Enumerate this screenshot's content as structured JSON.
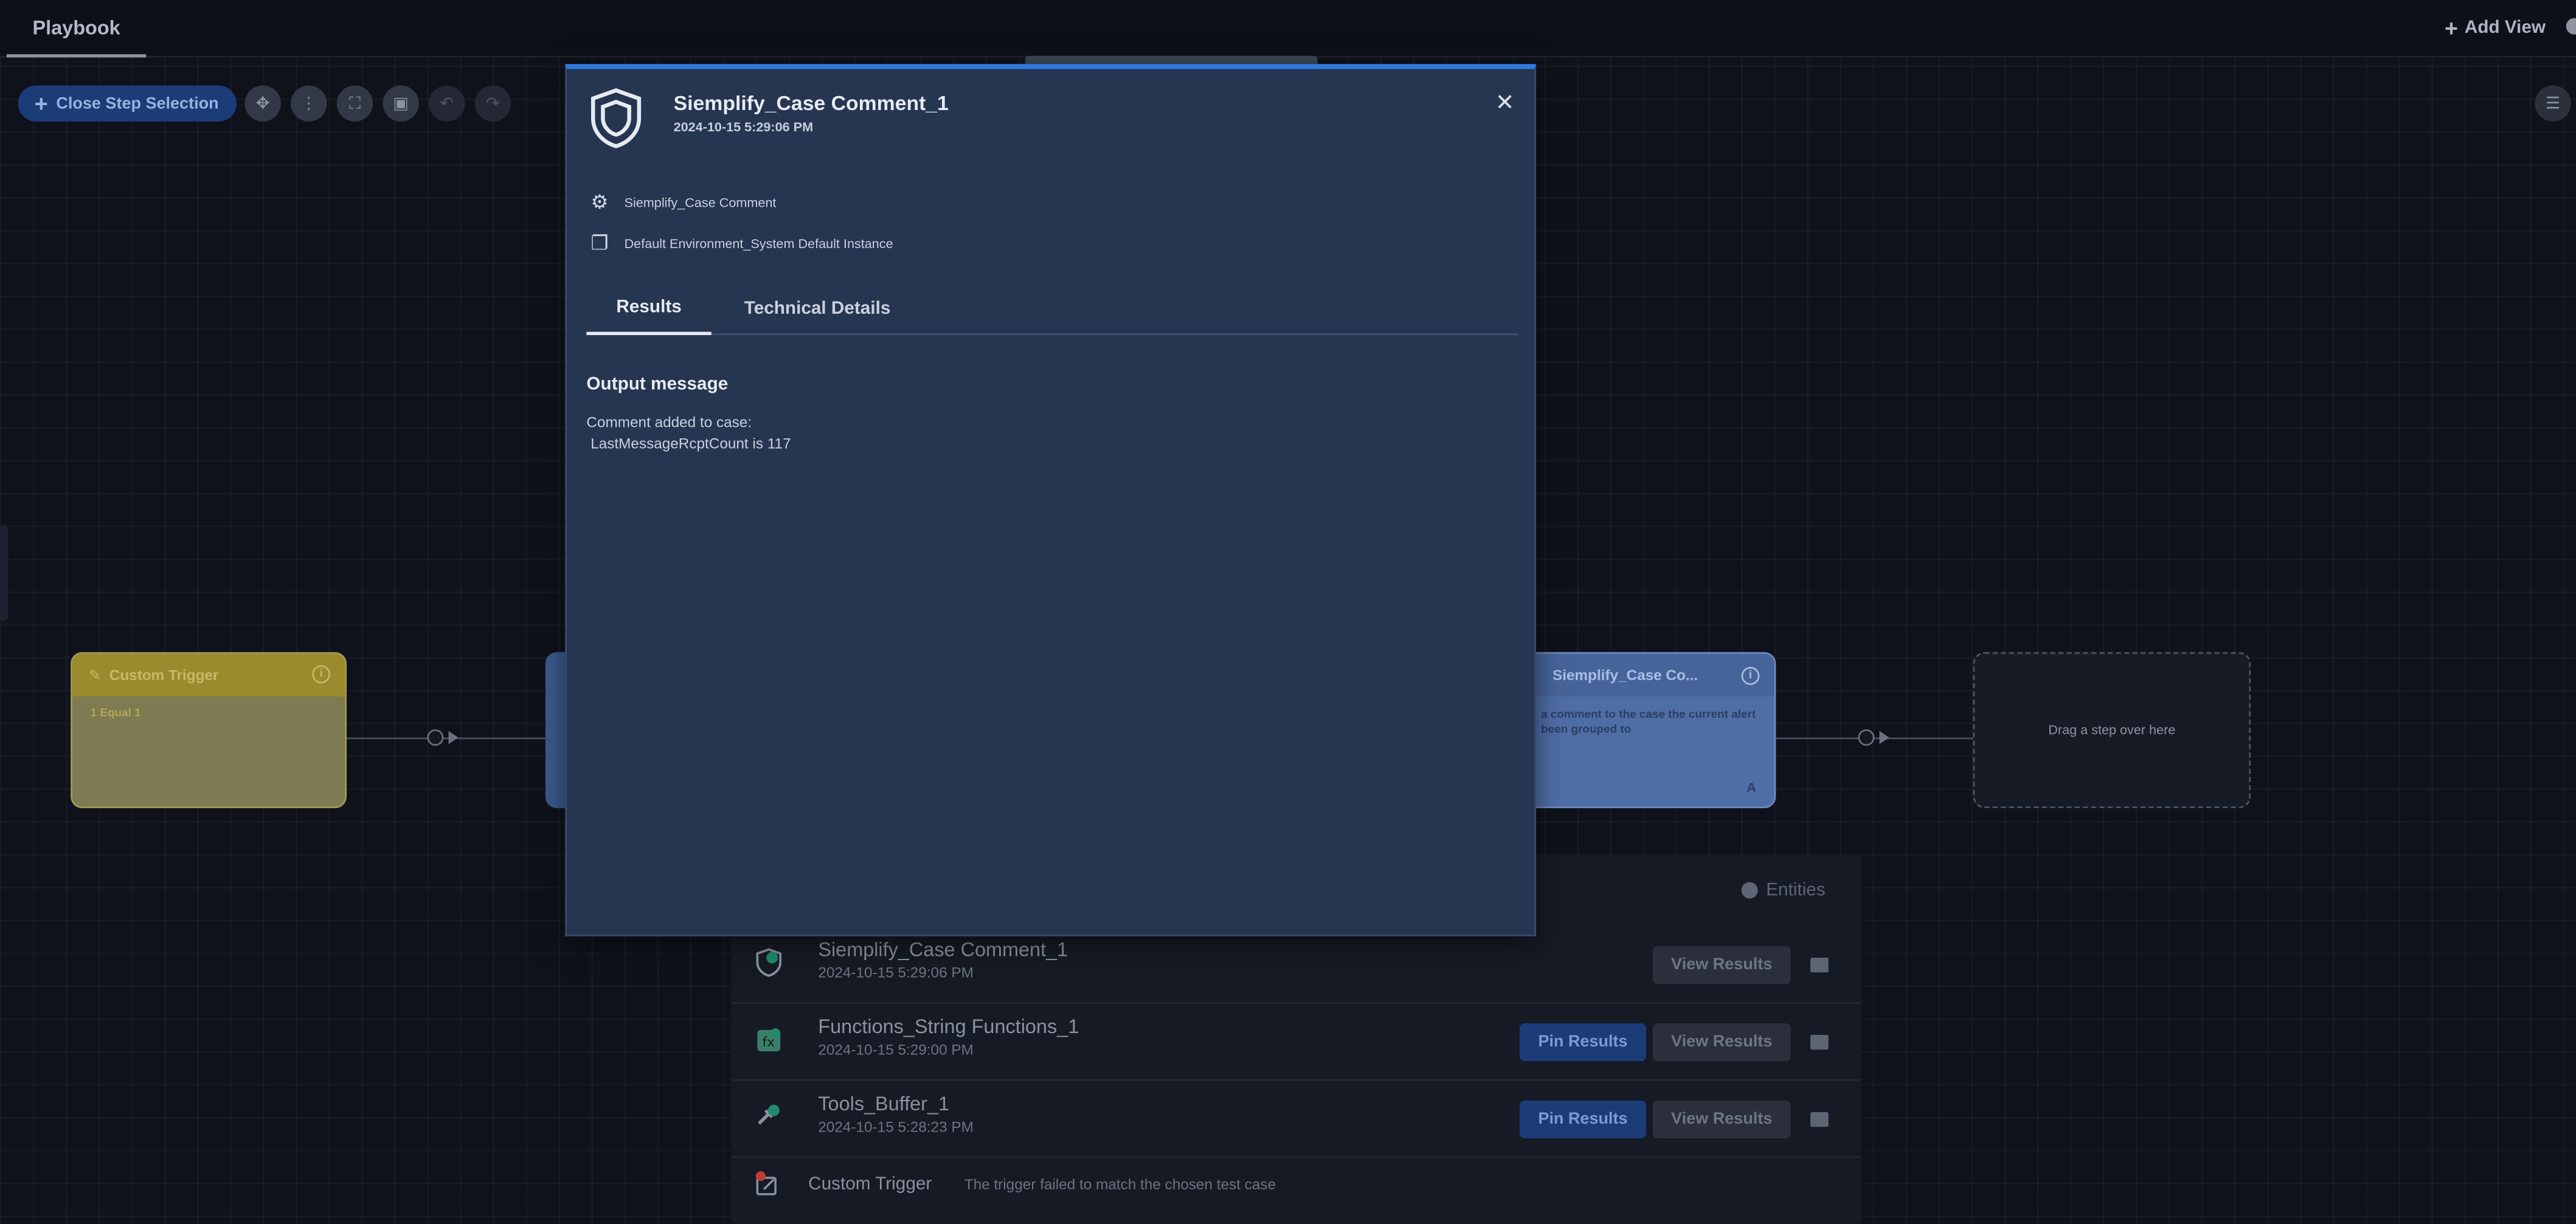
{
  "header": {
    "tab_label": "Playbook",
    "add_view_label": "Add View"
  },
  "toolbar": {
    "close_step_label": "Close Step Selection",
    "tools": [
      {
        "icon": "move-icon",
        "glyph": "✥",
        "enabled": true
      },
      {
        "icon": "share-nodes-icon",
        "glyph": "⋮",
        "enabled": true
      },
      {
        "icon": "fit-screen-icon",
        "glyph": "⛶",
        "enabled": true
      },
      {
        "icon": "image-export-icon",
        "glyph": "▣",
        "enabled": true
      },
      {
        "icon": "undo-icon",
        "glyph": "↶",
        "enabled": false
      },
      {
        "icon": "redo-icon",
        "glyph": "↷",
        "enabled": false
      }
    ],
    "side_panel_icon": "list-panel-icon"
  },
  "canvas": {
    "trigger_node": {
      "title": "Custom Trigger",
      "condition": "1 Equal 1"
    },
    "case_node": {
      "title": "Siemplify_Case Co...",
      "description": "a comment to the case the current alert been grouped to",
      "badge": "A"
    },
    "drop_zone": "Drag a step over here"
  },
  "modal": {
    "title": "Siemplify_Case Comment_1",
    "timestamp": "2024-10-15 5:29:06 PM",
    "integration": "Siemplify_Case Comment",
    "instance": "Default Environment_System Default Instance",
    "tabs": [
      "Results",
      "Technical Details"
    ],
    "output_title": "Output message",
    "output_text": "Comment added to case:\n LastMessageRcptCount is 117",
    "close_glyph": "✕"
  },
  "results": {
    "entities_label": "Entities",
    "rows": [
      {
        "title": "Siemplify_Case Comment_1",
        "timestamp": "2024-10-15 5:29:06 PM",
        "pin": false,
        "view_label": "View Results"
      },
      {
        "title": "Functions_String Functions_1",
        "timestamp": "2024-10-15 5:29:00 PM",
        "pin": true,
        "pin_label": "Pin Results",
        "view_label": "View Results"
      },
      {
        "title": "Tools_Buffer_1",
        "timestamp": "2024-10-15 5:28:23 PM",
        "pin": true,
        "pin_label": "Pin Results",
        "view_label": "View Results"
      }
    ],
    "trigger_row": {
      "title": "Custom Trigger",
      "message": "The trigger failed to match the chosen test case"
    }
  },
  "colors": {
    "accent": "#2e7be0",
    "modal_bg": "#263550",
    "trigger_yellow": "#9b8b2e",
    "pin_button": "#1c3c78"
  }
}
